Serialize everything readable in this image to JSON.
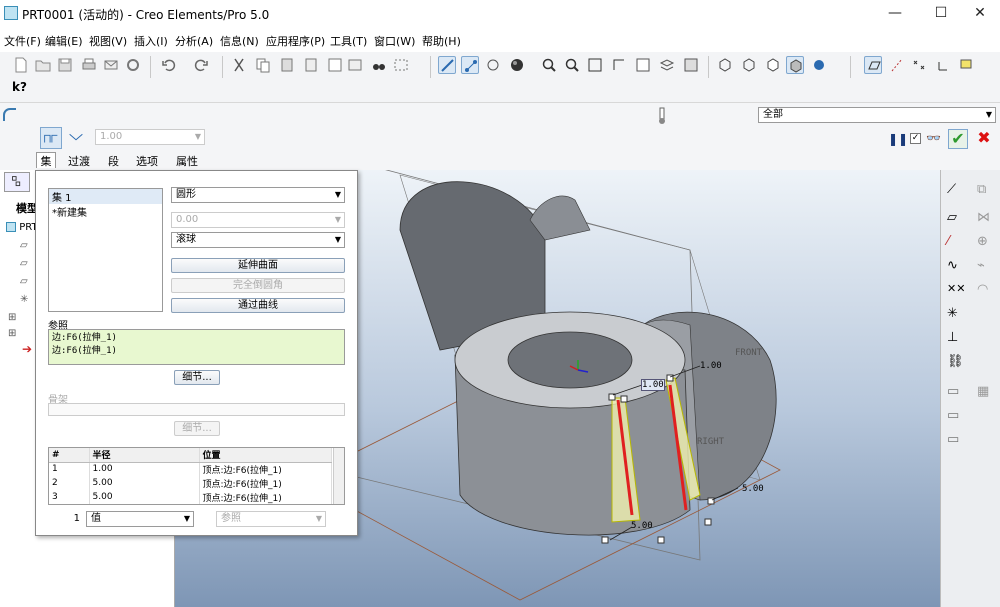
{
  "window": {
    "title": "PRT0001 (活动的) - Creo Elements/Pro 5.0",
    "minimize": "—",
    "maximize": "☐",
    "close": "✕"
  },
  "menu": [
    "文件(F)",
    "编辑(E)",
    "视图(V)",
    "插入(I)",
    "分析(A)",
    "信息(N)",
    "应用程序(P)",
    "工具(T)",
    "窗口(W)",
    "帮助(H)"
  ],
  "toolbar": {
    "whats_this": "k?"
  },
  "dashboard": {
    "filter_value": "全部",
    "radius_placeholder": "1.00",
    "tabs": [
      "集",
      "过渡",
      "段",
      "选项",
      "属性"
    ],
    "pause_icon": "pause-icon",
    "preview_icon": "glasses-icon",
    "accent_ok": "#2e9a2e",
    "accent_cancel": "#d11"
  },
  "left_panel": {
    "tab_label": "模型",
    "tree_root": "PRT"
  },
  "set_panel": {
    "sets": [
      "集 1",
      "*新建集"
    ],
    "shape_type": "圆形",
    "value_disabled": "0.00",
    "method": "滚球",
    "btn_extend_surface": "延伸曲面",
    "btn_full_round": "完全倒圆角",
    "btn_through_curve": "通过曲线",
    "references_label": "参照",
    "references": [
      "边:F6(拉伸_1)",
      "边:F6(拉伸_1)"
    ],
    "details_button": "细节...",
    "skeleton_label": "骨架",
    "details_button_2": "细节...",
    "table": {
      "headers": [
        "#",
        "半径",
        "位置"
      ],
      "rows": [
        [
          "1",
          "1.00",
          "顶点:边:F6(拉伸_1)"
        ],
        [
          "2",
          "5.00",
          "顶点:边:F6(拉伸_1)"
        ],
        [
          "3",
          "5.00",
          "顶点:边:F6(拉伸_1)"
        ]
      ]
    },
    "footer_index": "1",
    "footer_value": "值",
    "footer_ref": "参照"
  },
  "viewport": {
    "dim_1": "1.00",
    "dim_2": "1.00",
    "dim_3": "5.00",
    "dim_4": "5.00",
    "label_front": "FRONT",
    "label_right": "RIGHT"
  }
}
